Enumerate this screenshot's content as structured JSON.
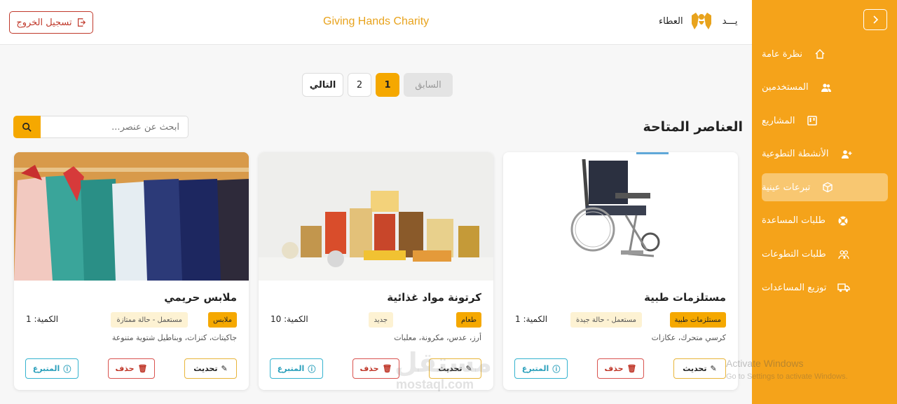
{
  "header": {
    "logout_label": "تسجيل الخروج",
    "brand_title": "Giving Hands Charity",
    "logo_text_right": "يـــد",
    "logo_text_left": "العطاء"
  },
  "sidebar": {
    "items": [
      {
        "label": "نظرة عامة",
        "icon": "home-icon"
      },
      {
        "label": "المستخدمين",
        "icon": "users-icon"
      },
      {
        "label": "المشاريع",
        "icon": "projects-icon"
      },
      {
        "label": "الأنشطة التطوعية",
        "icon": "user-plus-icon"
      },
      {
        "label": "تبرعات عينية",
        "icon": "box-icon",
        "active": true
      },
      {
        "label": "طلبات المساعدة",
        "icon": "lifebuoy-icon"
      },
      {
        "label": "طلبات التطوعات",
        "icon": "volunteers-icon"
      },
      {
        "label": "توزيع المساعدات",
        "icon": "truck-icon"
      }
    ]
  },
  "pagination": {
    "prev": "السابق",
    "page1": "1",
    "page2": "2",
    "next": "التالي"
  },
  "section": {
    "title": "العناصر المتاحة",
    "search_placeholder": "ابحث عن عنصر..."
  },
  "cards": [
    {
      "title": "مستلزمات طبية",
      "category": "مستلزمات طبية",
      "condition": "مستعمل - حالة جيدة",
      "quantity": "الكمية: 1",
      "description": "كرسي متحرك، عكازات",
      "update": "تحديث",
      "delete": "حذف",
      "donor": "المتبرع"
    },
    {
      "title": "كرتونة مواد غذائية",
      "category": "طعام",
      "condition": "جديد",
      "quantity": "الكمية: 10",
      "description": "أرز، عدس، مكرونة، معلبات",
      "update": "تحديث",
      "delete": "حذف",
      "donor": "المتبرع"
    },
    {
      "title": "ملابس حريمي",
      "category": "ملابس",
      "condition": "مستعمل - حالة ممتازة",
      "quantity": "الكمية: 1",
      "description": "جاكيتات، كنزات، وبناطيل شتوية متنوعة",
      "update": "تحديث",
      "delete": "حذف",
      "donor": "المتبرع"
    }
  ],
  "watermarks": {
    "mostaql_ar": "مستقل",
    "mostaql_en": "mostaql.com",
    "windows_line1": "Activate Windows",
    "windows_line2": "Go to Settings to activate Windows."
  },
  "colors": {
    "accent": "#f5a31a",
    "primary_button": "#f5a800",
    "danger": "#c0392b",
    "info": "#35b3cf"
  }
}
